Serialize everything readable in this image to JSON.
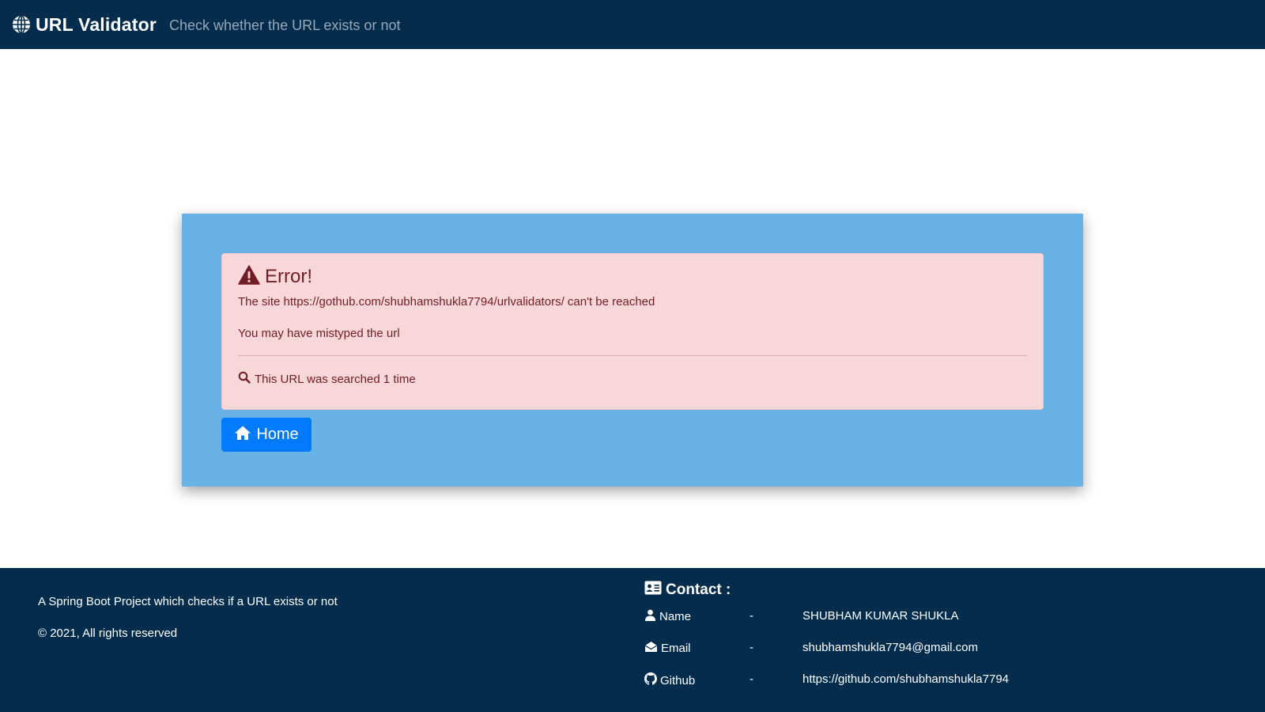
{
  "header": {
    "brand": "URL Validator",
    "tagline": "Check whether the URL exists or not",
    "brand_icon": "globe-icon"
  },
  "alert": {
    "icon": "warning-icon",
    "title": "Error!",
    "message": "The site https://gothub.com/shubhamshukla7794/urlvalidators/ can't be reached",
    "hint": "You may have mistyped the url",
    "search_icon": "search-icon",
    "search_count": "This URL was searched 1 time"
  },
  "home_button": {
    "icon": "home-icon",
    "label": "Home"
  },
  "footer": {
    "about": "A Spring Boot Project which checks if a URL exists or not",
    "copyright": "© 2021, All rights reserved",
    "contact": {
      "heading": "Contact :",
      "heading_icon": "contact-card-icon",
      "rows": [
        {
          "icon": "user-icon",
          "label": "Name",
          "separator": "-",
          "value": "SHUBHAM KUMAR SHUKLA"
        },
        {
          "icon": "envelope-icon",
          "label": "Email",
          "separator": "-",
          "value": "shubhamshukla7794@gmail.com"
        },
        {
          "icon": "github-icon",
          "label": "Github",
          "separator": "-",
          "value": "https://github.com/shubhamshukla7794"
        }
      ]
    }
  },
  "colors": {
    "navbar": "#042c4d",
    "card": "#68b2e6",
    "alert_bg": "#f8d7da",
    "alert_text": "#721c24",
    "button": "#007bff"
  }
}
